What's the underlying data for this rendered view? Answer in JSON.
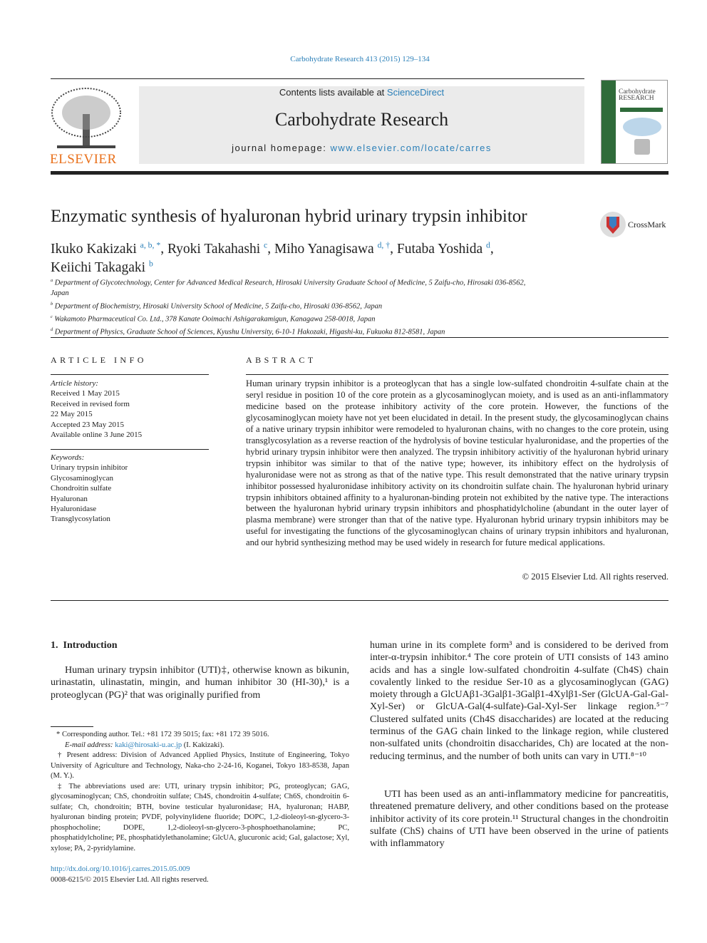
{
  "journal_ref": "Carbohydrate Research 413 (2015) 129–134",
  "header": {
    "contents_prefix": "Contents lists available at ",
    "contents_link": "ScienceDirect",
    "journal_name": "Carbohydrate Research",
    "homepage_prefix": "journal homepage: ",
    "homepage_link": "www.elsevier.com/locate/carres",
    "publisher_logo": "ELSEVIER",
    "cover_title": "Carbohydrate RESEARCH"
  },
  "title": "Enzymatic synthesis of hyaluronan hybrid urinary trypsin inhibitor",
  "crossmark": "CrossMark",
  "authors": [
    {
      "name": "Ikuko Kakizaki",
      "sup": "a, b, *"
    },
    {
      "name": "Ryoki Takahashi",
      "sup": "c"
    },
    {
      "name": "Miho Yanagisawa",
      "sup": "d, †"
    },
    {
      "name": "Futaba Yoshida",
      "sup": "d"
    },
    {
      "name": "Keiichi Takagaki",
      "sup": "b"
    }
  ],
  "affiliations": [
    {
      "sup": "a",
      "text": "Department of Glycotechnology, Center for Advanced Medical Research, Hirosaki University Graduate School of Medicine, 5 Zaifu-cho, Hirosaki 036-8562, Japan"
    },
    {
      "sup": "b",
      "text": "Department of Biochemistry, Hirosaki University School of Medicine, 5 Zaifu-cho, Hirosaki 036-8562, Japan"
    },
    {
      "sup": "c",
      "text": "Wakamoto Pharmaceutical Co. Ltd., 378 Kanate Ooimachi Ashigarakamigun, Kanagawa 258-0018, Japan"
    },
    {
      "sup": "d",
      "text": "Department of Physics, Graduate School of Sciences, Kyushu University, 6-10-1 Hakozaki, Higashi-ku, Fukuoka 812-8581, Japan"
    }
  ],
  "article_info": {
    "heading": "ARTICLE INFO",
    "history_label": "Article history:",
    "history": [
      "Received 1 May 2015",
      "Received in revised form",
      "22 May 2015",
      "Accepted 23 May 2015",
      "Available online 3 June 2015"
    ],
    "keywords_label": "Keywords:",
    "keywords": [
      "Urinary trypsin inhibitor",
      "Glycosaminoglycan",
      "Chondroitin sulfate",
      "Hyaluronan",
      "Hyaluronidase",
      "Transglycosylation"
    ]
  },
  "abstract": {
    "heading": "ABSTRACT",
    "text": "Human urinary trypsin inhibitor is a proteoglycan that has a single low-sulfated chondroitin 4-sulfate chain at the seryl residue in position 10 of the core protein as a glycosaminoglycan moiety, and is used as an anti-inflammatory medicine based on the protease inhibitory activity of the core protein. However, the functions of the glycosaminoglycan moiety have not yet been elucidated in detail. In the present study, the glycosaminoglycan chains of a native urinary trypsin inhibitor were remodeled to hyaluronan chains, with no changes to the core protein, using transglycosylation as a reverse reaction of the hydrolysis of bovine testicular hyaluronidase, and the properties of the hybrid urinary trypsin inhibitor were then analyzed. The trypsin inhibitory activitiy of the hyaluronan hybrid urinary trypsin inhibitor was similar to that of the native type; however, its inhibitory effect on the hydrolysis of hyaluronidase were not as strong as that of the native type. This result demonstrated that the native urinary trypsin inhibitor possessed hyaluronidase inhibitory activity on its chondroitin sulfate chain. The hyaluronan hybrid urinary trypsin inhibitors obtained affinity to a hyaluronan-binding protein not exhibited by the native type. The interactions between the hyaluronan hybrid urinary trypsin inhibitors and phosphatidylcholine (abundant in the outer layer of plasma membrane) were stronger than that of the native type. Hyaluronan hybrid urinary trypsin inhibitors may be useful for investigating the functions of the glycosaminoglycan chains of urinary trypsin inhibitors and hyaluronan, and our hybrid synthesizing method may be used widely in research for future medical applications.",
    "copyright": "© 2015 Elsevier Ltd. All rights reserved."
  },
  "intro": {
    "heading": "1.  Introduction",
    "left": "Human urinary trypsin inhibitor (UTI)‡, otherwise known as bikunin, urinastatin, ulinastatin, mingin, and human inhibitor 30 (HI-30),¹ is a proteoglycan (PG)² that was originally purified from",
    "right_p1": "human urine in its complete form³ and is considered to be derived from inter-α-trypsin inhibitor.⁴ The core protein of UTI consists of 143 amino acids and has a single low-sulfated chondroitin 4-sulfate (Ch4S) chain covalently linked to the residue Ser-10 as a glycosaminoglycan (GAG) moiety through a GlcUAβ1-3Galβ1-3Galβ1-4Xylβ1-Ser (GlcUA-Gal-Gal-Xyl-Ser) or GlcUA-Gal(4-sulfate)-Gal-Xyl-Ser linkage region.⁵⁻⁷ Clustered sulfated units (Ch4S disaccharides) are located at the reducing terminus of the GAG chain linked to the linkage region, while clustered non-sulfated units (chondroitin disaccharides, Ch) are located at the non-reducing terminus, and the number of both units can vary in UTI.⁸⁻¹⁰",
    "right_p2": "UTI has been used as an anti-inflammatory medicine for pancreatitis, threatened premature delivery, and other conditions based on the protease inhibitor activity of its core protein.¹¹ Structural changes in the chondroitin sulfate (ChS) chains of UTI have been observed in the urine of patients with inflammatory"
  },
  "footnotes": {
    "corresponding": "* Corresponding author. Tel.: +81 172 39 5015; fax: +81 172 39 5016.",
    "email_label": "E-mail address: ",
    "email": "kaki@hirosaki-u.ac.jp",
    "email_suffix": " (I. Kakizaki).",
    "present": "† Present address: Division of Advanced Applied Physics, Institute of Engineering, Tokyo University of Agriculture and Technology, Naka-cho 2-24-16, Koganei, Tokyo 183-8538, Japan (M. Y.).",
    "abbrev": "‡ The abbreviations used are: UTI, urinary trypsin inhibitor; PG, proteoglycan; GAG, glycosaminoglycan; ChS, chondroitin sulfate; Ch4S, chondroitin 4-sulfate; Ch6S, chondroitin 6-sulfate; Ch, chondroitin; BTH, bovine testicular hyaluronidase; HA, hyaluronan; HABP, hyaluronan binding protein; PVDF, polyvinylidene fluoride; DOPC, 1,2-dioleoyl-sn-glycero-3-phosphocholine; DOPE, 1,2-dioleoyl-sn-glycero-3-phosphoethanolamine; PC, phosphatidylcholine; PE, phosphatidylethanolamine; GlcUA, glucuronic acid; Gal, galactose; Xyl, xylose; PA, 2-pyridylamine.",
    "doi": "http://dx.doi.org/10.1016/j.carres.2015.05.009",
    "issn": "0008-6215/© 2015 Elsevier Ltd. All rights reserved."
  },
  "colors": {
    "link": "#2a7fb8",
    "elsevier_orange": "#e9711c"
  }
}
